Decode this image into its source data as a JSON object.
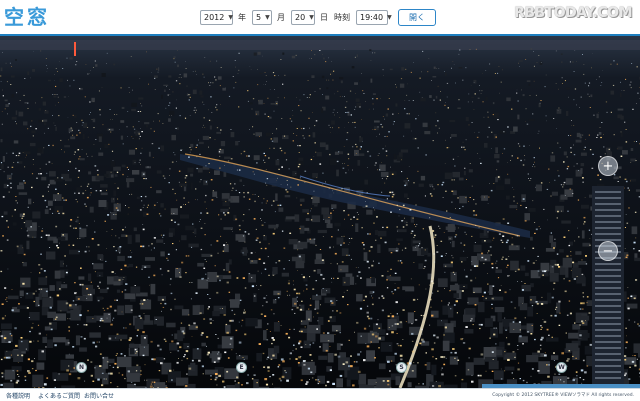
{
  "logo": {
    "char1": "空",
    "char2": "窓"
  },
  "controls": {
    "year": "2012",
    "year_unit": "年",
    "month": "5",
    "month_unit": "月",
    "day": "20",
    "day_unit": "日",
    "time_label": "時刻",
    "time": "19:40",
    "open_label": "開く"
  },
  "watermark": "RBBTODAY.COM",
  "view": {
    "zoom_in": "+",
    "zoom_out": "−",
    "compass": [
      "N",
      "E",
      "S",
      "W"
    ]
  },
  "footer": {
    "links": [
      "各種説明",
      "よくあるご質問",
      "お問い合せ"
    ],
    "copyright": "Copyright © 2012 SKYTREE® VIEWソラマド All rights reserved."
  },
  "colors": {
    "accent": "#1e7fbf",
    "logo": "#3a9ad9",
    "night_sky": "#06080c"
  }
}
